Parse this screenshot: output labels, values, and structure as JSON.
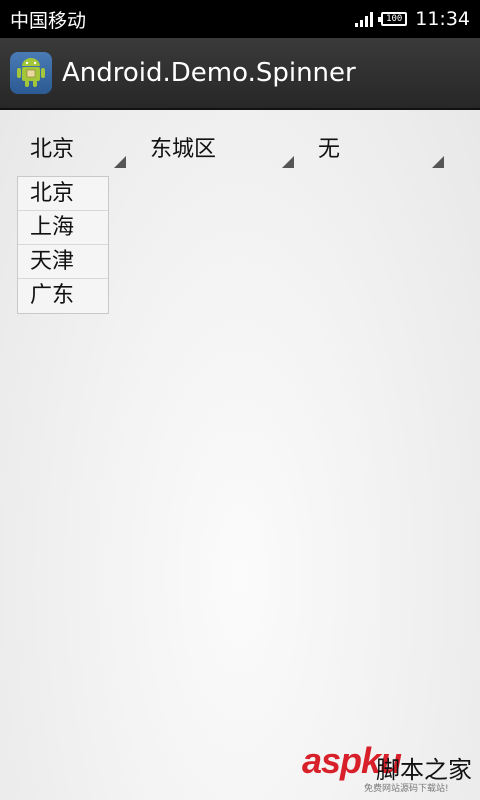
{
  "status_bar": {
    "carrier": "中国移动",
    "battery": "100",
    "time": "11:34"
  },
  "title_bar": {
    "icon": "android-icon",
    "title": "Android.Demo.Spinner"
  },
  "spinners": {
    "province": {
      "selected": "北京"
    },
    "district": {
      "selected": "东城区"
    },
    "extra": {
      "selected": "无"
    }
  },
  "dropdown": {
    "items": [
      "北京",
      "上海",
      "天津",
      "广东"
    ]
  },
  "watermark": {
    "brand": "aspku",
    "side_text": "脚本之家",
    "subtitle": "免费网站源码下载站!"
  },
  "colors": {
    "status_bar_bg": "#000000",
    "title_bar_bg": "#2f2f2f",
    "watermark_red": "#d7202a"
  }
}
